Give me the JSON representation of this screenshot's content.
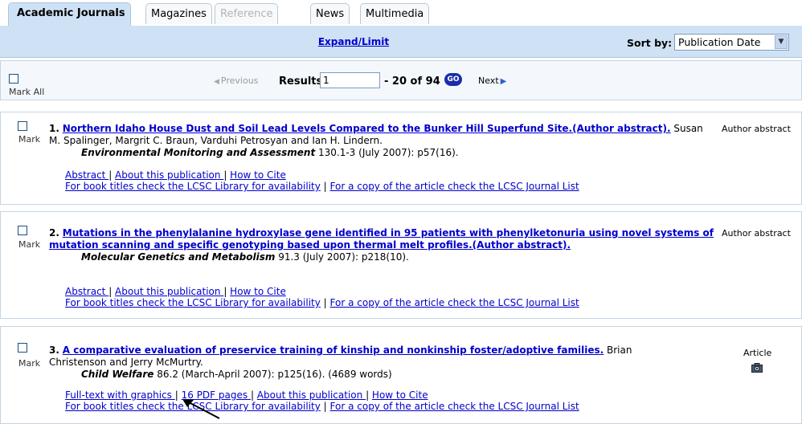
{
  "tabs": [
    {
      "label": "Academic Journals",
      "state": "active"
    },
    {
      "label": "Magazines",
      "state": "normal"
    },
    {
      "label": "Reference",
      "state": "disabled"
    },
    {
      "label": "News",
      "state": "normal"
    },
    {
      "label": "Multimedia",
      "state": "normal"
    }
  ],
  "toolbar": {
    "expand_limit": "Expand/Limit",
    "sort_label": "Sort by:",
    "sort_value": "Publication Date"
  },
  "results": {
    "mark_all": "Mark All",
    "previous": "Previous",
    "results_label": "Results",
    "start_value": "1",
    "range_text": "- 20  of 94",
    "go": "GO",
    "next": "Next"
  },
  "records": [
    {
      "number": "1.",
      "title": "Northern Idaho House Dust and Soil Lead Levels Compared to the Bunker Hill Superfund Site.(Author abstract).",
      "authors": " Susan M. Spalinger, Margrit C. Braun, Varduhi Petrosyan and Ian H. Lindern.",
      "journal": "Environmental Monitoring and Assessment",
      "citation": " 130.1-3 (July 2007): p57(16).",
      "mark": "Mark",
      "doctype": "Author abstract",
      "links_row1": [
        "Abstract ",
        "About this publication ",
        "How to Cite"
      ],
      "links_row2": [
        "For book titles check the LCSC Library for availability",
        "For a copy of the article check the LCSC Journal List"
      ]
    },
    {
      "number": "2.",
      "title": "Mutations in the phenylalanine hydroxylase gene identified in 95 patients with phenylketonuria using novel systems of mutation scanning and specific genotyping based upon thermal melt profiles.(Author abstract).",
      "authors": "",
      "journal": "Molecular Genetics and Metabolism",
      "citation": " 91.3 (July 2007): p218(10).",
      "mark": "Mark",
      "doctype": "Author abstract",
      "links_row1": [
        "Abstract ",
        "About this publication ",
        "How to Cite"
      ],
      "links_row2": [
        "For book titles check the LCSC Library for availability",
        "For a copy of the article check the LCSC Journal List"
      ]
    },
    {
      "number": "3.",
      "title": "A comparative evaluation of preservice training of kinship and nonkinship foster/adoptive families.",
      "authors": " Brian Christenson and Jerry McMurtry.",
      "journal": "Child Welfare",
      "citation": " 86.2 (March-April 2007): p125(16). (4689 words)",
      "mark": "Mark",
      "doctype": "Article",
      "links_row1": [
        "Full-text with graphics ",
        "16 PDF pages ",
        "About this publication ",
        "How to Cite"
      ],
      "links_row2": [
        "For book titles check the LCSC Library for availability",
        "For a copy of the article check the LCSC Journal List"
      ]
    }
  ]
}
